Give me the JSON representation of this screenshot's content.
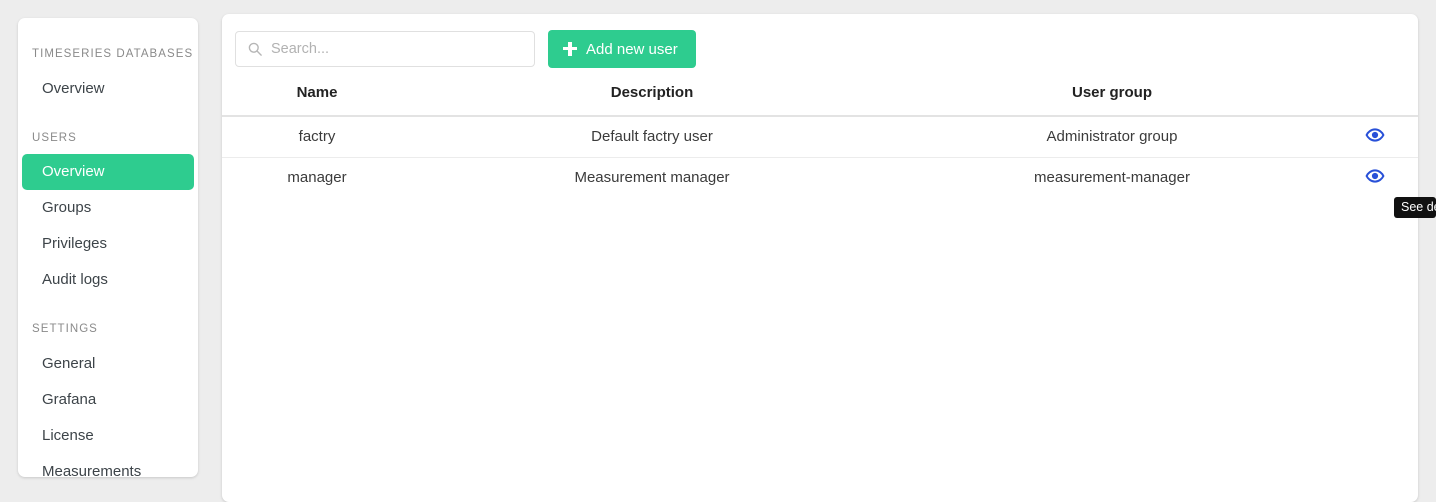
{
  "sidebar": {
    "sections": [
      {
        "label": "TIMESERIES DATABASES",
        "items": [
          {
            "label": "Overview",
            "active": false
          }
        ]
      },
      {
        "label": "USERS",
        "items": [
          {
            "label": "Overview",
            "active": true
          },
          {
            "label": "Groups",
            "active": false
          },
          {
            "label": "Privileges",
            "active": false
          },
          {
            "label": "Audit logs",
            "active": false
          }
        ]
      },
      {
        "label": "SETTINGS",
        "items": [
          {
            "label": "General",
            "active": false
          },
          {
            "label": "Grafana",
            "active": false
          },
          {
            "label": "License",
            "active": false
          },
          {
            "label": "Measurements",
            "active": false
          }
        ]
      }
    ]
  },
  "toolbar": {
    "search_placeholder": "Search...",
    "search_value": "",
    "search_icon": "search-icon",
    "add_button_label": "Add new user",
    "add_button_icon": "plus-icon"
  },
  "table": {
    "columns": [
      "Name",
      "Description",
      "User group",
      ""
    ],
    "rows": [
      {
        "name": "factry",
        "description": "Default factry user",
        "user_group": "Administrator group",
        "action_icon": "eye-icon"
      },
      {
        "name": "manager",
        "description": "Measurement manager",
        "user_group": "measurement-manager",
        "action_icon": "eye-icon"
      }
    ]
  },
  "tooltip": {
    "text": "See details",
    "visible_text": "See de"
  },
  "colors": {
    "accent_green": "#2ecc8f",
    "eye_blue": "#2850d8",
    "page_background": "#ededed",
    "card_background": "#ffffff",
    "muted_text": "#8a8a8a"
  }
}
